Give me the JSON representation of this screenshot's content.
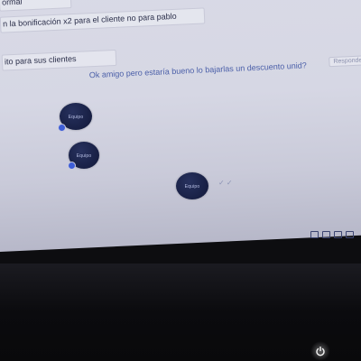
{
  "messages": [
    {
      "text": "ormal",
      "time": ""
    },
    {
      "text": "n la bonificación x2 para el cliente no para pablo",
      "time": ""
    },
    {
      "text": "ito para sus clientes",
      "time": ""
    }
  ],
  "incoming": {
    "text": "Ok amigo pero estaría bueno lo bajarlas un descuento unid?",
    "action": "Responder"
  },
  "avatars": [
    {
      "initials": "Equipo"
    },
    {
      "initials": "Equipo"
    },
    {
      "initials": "Equipo"
    }
  ],
  "read_indicator": "✓ ✓",
  "tray": {
    "icons": [
      "wifi-icon",
      "window-icon",
      "battery-icon",
      "arrow-icon"
    ]
  },
  "colors": {
    "screen": "#d8d9e6",
    "avatar": "#1c2450",
    "badge": "#3e5ed8",
    "bezel": "#0d0d10"
  }
}
